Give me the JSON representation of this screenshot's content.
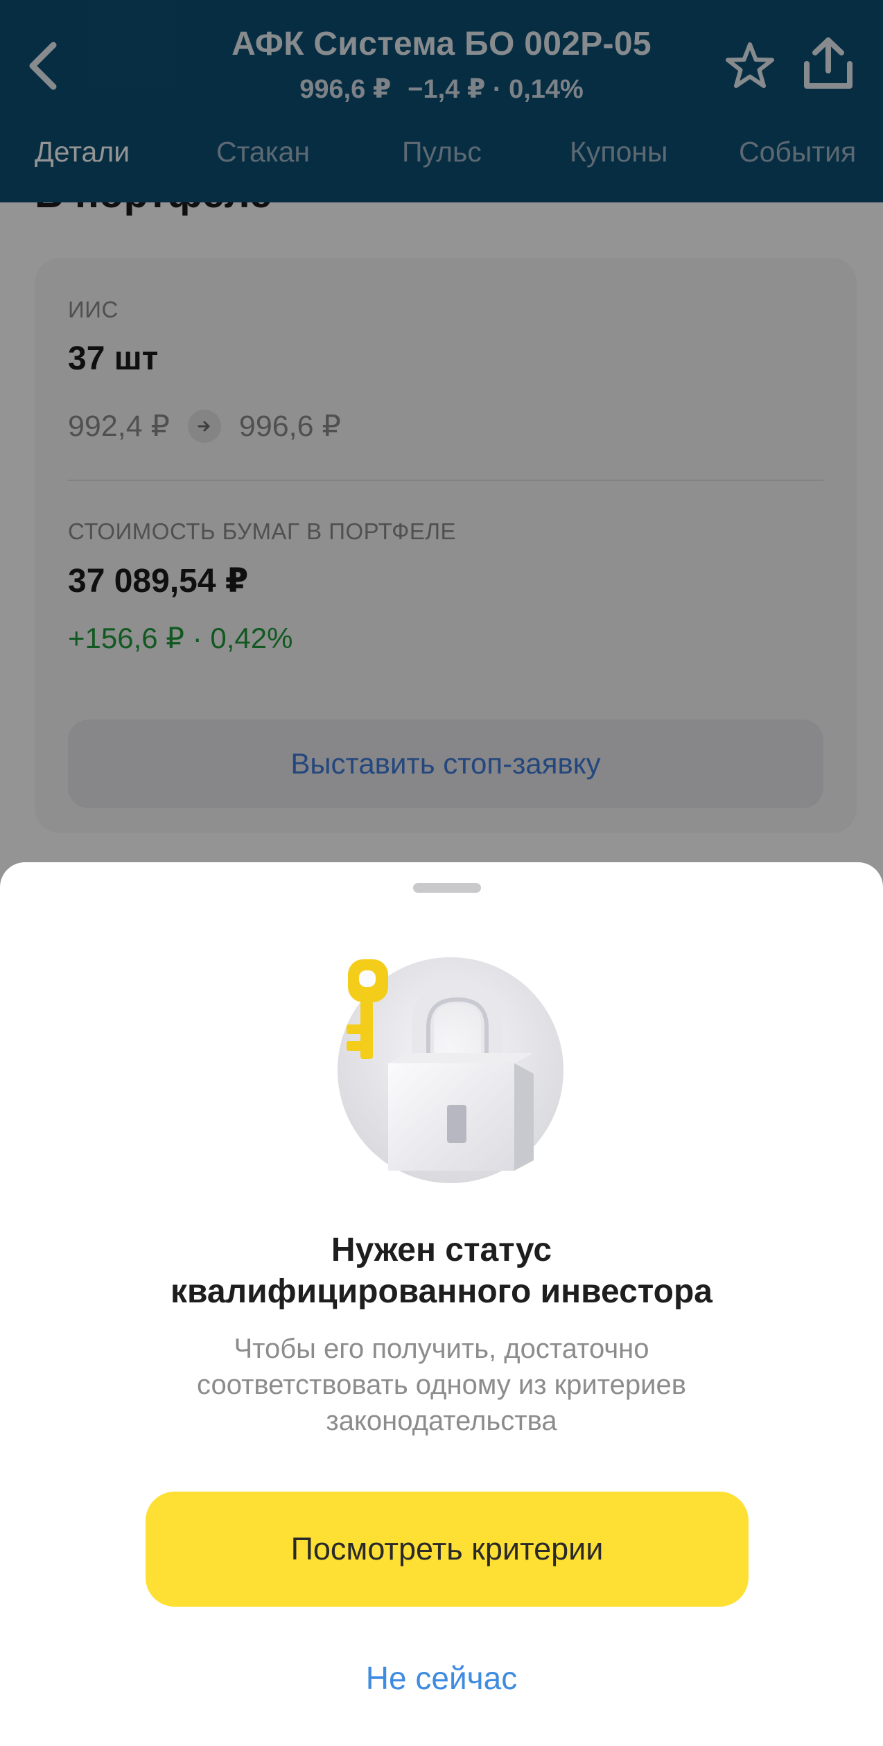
{
  "header": {
    "title": "АФК Система БО 002Р-05",
    "price": "996,6 ₽",
    "change": "−1,4 ₽ · 0,14%",
    "icons": {
      "back": "chevron-left-icon",
      "favorite": "star-icon",
      "share": "share-icon"
    },
    "tabs": [
      {
        "label": "Детали",
        "active": true
      },
      {
        "label": "Стакан",
        "active": false
      },
      {
        "label": "Пульс",
        "active": false
      },
      {
        "label": "Купоны",
        "active": false
      },
      {
        "label": "События",
        "active": false
      }
    ]
  },
  "portfolio": {
    "section_title_cut": "В портфеле",
    "account_label": "ИИС",
    "quantity": "37 шт",
    "buy_price": "992,4 ₽",
    "current_price": "996,6 ₽",
    "value_label": "СТОИМОСТЬ БУМАГ В ПОРТФЕЛЕ",
    "total_value": "37 089,54 ₽",
    "profit": "+156,6 ₽ · 0,42%",
    "stop_order_button": "Выставить стоп-заявку"
  },
  "sheet": {
    "title_line1": "Нужен статус",
    "title_line2": "квалифицированного инвестора",
    "text_line1": "Чтобы его получить, достаточно",
    "text_line2": "соответствовать одному из критериев",
    "text_line3": "законодательства",
    "primary_button": "Посмотреть критерии",
    "secondary_button": "Не сейчас",
    "illustration": "lock-key-icon"
  },
  "colors": {
    "header_bg": "#0d4f73",
    "accent_yellow": "#fde033",
    "link_blue": "#3f8be0",
    "profit_green": "#1f9a3a"
  }
}
